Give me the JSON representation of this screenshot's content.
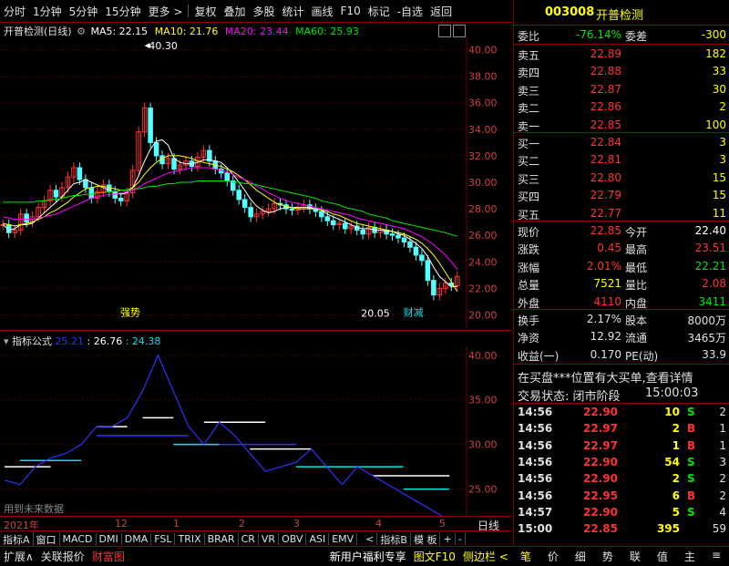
{
  "toolbar": {
    "period_tabs": [
      "分时",
      "1分钟",
      "5分钟",
      "15分钟",
      "更多 >"
    ],
    "tools": [
      "复权",
      "叠加",
      "多股",
      "统计",
      "画线",
      "F10",
      "标记",
      "-自选",
      "返回"
    ]
  },
  "stock": {
    "code": "003008",
    "name": "开普检测",
    "period_label": "开普检测(日线)"
  },
  "ma_legend": [
    {
      "label": "MA5: 22.15",
      "color": "#ffffff"
    },
    {
      "label": "MA10: 21.76",
      "color": "#ffff00"
    },
    {
      "label": "MA20: 23.44",
      "color": "#ff00ff"
    },
    {
      "label": "MA60: 25.93",
      "color": "#00e600"
    }
  ],
  "indicator": {
    "name": "指标公式",
    "values": [
      {
        "label": "25.21",
        "color": "#3030ff"
      },
      {
        "label": ": 26.76",
        "color": "#ffffff"
      },
      {
        "label": ": 24.38",
        "color": "#00e5e5"
      }
    ],
    "note": "用到未来数据"
  },
  "chart_data": [
    {
      "type": "candlestick",
      "title": "开普检测(日线)",
      "ylim": [
        19,
        41
      ],
      "yticks": [
        "40.00",
        "38.00",
        "36.00",
        "34.00",
        "32.00",
        "30.00",
        "28.00",
        "26.00",
        "24.00",
        "22.00",
        "20.00"
      ],
      "x_labels": [
        "2021年",
        "12",
        "1",
        "2",
        "3",
        "4",
        "5"
      ],
      "annotations": [
        {
          "text": "40.30"
        },
        {
          "text": "20.05"
        },
        {
          "text": "强势"
        },
        {
          "text": "财减"
        }
      ],
      "close": [
        26.8,
        26.2,
        26.4,
        27.6,
        27.0,
        27.4,
        28.1,
        28.6,
        29.4,
        28.9,
        29.6,
        30.4,
        31.1,
        30.2,
        29.6,
        28.8,
        29.3,
        29.8,
        29.3,
        28.8,
        28.6,
        29.2,
        30.9,
        33.8,
        35.6,
        33.0,
        32.0,
        31.4,
        31.8,
        31.0,
        31.3,
        31.6,
        31.2,
        31.9,
        32.4,
        31.6,
        31.0,
        30.7,
        30.1,
        29.4,
        28.7,
        28.1,
        27.4,
        27.6,
        27.8,
        28.0,
        28.4,
        28.3,
        28.0,
        27.9,
        28.1,
        28.3,
        28.0,
        27.8,
        27.4,
        27.1,
        26.8,
        26.9,
        26.5,
        26.7,
        26.4,
        26.1,
        26.6,
        26.2,
        26.4,
        26.1,
        26.0,
        25.8,
        25.5,
        25.1,
        24.5,
        24.1,
        22.6,
        21.5,
        22.0,
        22.4,
        22.2,
        22.9
      ],
      "ma_series": [
        {
          "name": "MA5",
          "color": "#ffffff",
          "values": [
            26.8,
            26.4,
            26.5,
            26.8,
            26.8,
            26.9,
            27.3,
            27.7,
            28.1,
            28.5,
            28.9,
            29.4,
            29.9,
            30.0,
            30.2,
            30.0,
            29.8,
            29.6,
            29.4,
            29.2,
            29.1,
            29.2,
            29.6,
            30.5,
            31.6,
            32.5,
            33.1,
            33.2,
            32.8,
            31.8,
            31.5,
            31.4,
            31.4,
            31.5,
            31.7,
            31.7,
            31.6,
            31.5,
            31.1,
            30.6,
            30.0,
            29.4,
            28.7,
            28.2,
            27.9,
            27.7,
            27.8,
            28.0,
            28.1,
            28.1,
            28.1,
            28.1,
            28.1,
            28.0,
            27.9,
            27.6,
            27.4,
            27.2,
            27.0,
            26.8,
            26.6,
            26.5,
            26.5,
            26.4,
            26.4,
            26.3,
            26.3,
            26.1,
            26.0,
            25.7,
            25.4,
            25.0,
            24.4,
            23.6,
            22.9,
            22.5,
            22.1,
            22.15
          ]
        },
        {
          "name": "MA10",
          "color": "#ffff00",
          "values": [
            26.9,
            26.8,
            26.7,
            26.8,
            26.9,
            27.0,
            27.2,
            27.4,
            27.7,
            27.9,
            28.2,
            28.5,
            28.9,
            29.2,
            29.5,
            29.6,
            29.7,
            29.7,
            29.6,
            29.5,
            29.4,
            29.4,
            29.6,
            30.0,
            30.6,
            31.1,
            31.5,
            31.8,
            32.0,
            32.0,
            32.0,
            31.9,
            31.8,
            31.6,
            31.5,
            31.4,
            31.3,
            31.2,
            31.0,
            30.8,
            30.5,
            30.2,
            29.8,
            29.4,
            29.1,
            28.8,
            28.5,
            28.3,
            28.2,
            28.1,
            28.0,
            28.0,
            28.0,
            28.0,
            27.9,
            27.8,
            27.6,
            27.5,
            27.3,
            27.1,
            26.9,
            26.8,
            26.7,
            26.6,
            26.5,
            26.4,
            26.3,
            26.2,
            26.1,
            25.9,
            25.7,
            25.4,
            25.0,
            24.5,
            23.9,
            23.2,
            22.5,
            21.76
          ]
        },
        {
          "name": "MA20",
          "color": "#ff00ff",
          "values": [
            27.4,
            27.3,
            27.2,
            27.2,
            27.2,
            27.2,
            27.3,
            27.4,
            27.5,
            27.6,
            27.8,
            28.0,
            28.2,
            28.4,
            28.6,
            28.8,
            28.9,
            29.0,
            29.1,
            29.1,
            29.2,
            29.3,
            29.4,
            29.6,
            29.9,
            30.1,
            30.3,
            30.5,
            30.7,
            30.8,
            30.9,
            31.0,
            31.1,
            31.1,
            31.1,
            31.1,
            31.0,
            30.9,
            30.8,
            30.6,
            30.4,
            30.2,
            30.0,
            29.7,
            29.5,
            29.2,
            29.0,
            28.8,
            28.6,
            28.5,
            28.4,
            28.3,
            28.2,
            28.1,
            28.0,
            27.9,
            27.8,
            27.7,
            27.6,
            27.5,
            27.3,
            27.2,
            27.1,
            27.0,
            26.9,
            26.8,
            26.7,
            26.6,
            26.5,
            26.3,
            26.1,
            25.9,
            25.6,
            25.3,
            24.9,
            24.5,
            24.0,
            23.44
          ]
        },
        {
          "name": "MA60",
          "color": "#00e600",
          "values": [
            28.5,
            28.5,
            28.5,
            28.5,
            28.5,
            28.5,
            28.6,
            28.6,
            28.7,
            28.7,
            28.8,
            28.9,
            29.0,
            29.0,
            29.1,
            29.1,
            29.2,
            29.2,
            29.3,
            29.3,
            29.4,
            29.4,
            29.5,
            29.5,
            29.6,
            29.7,
            29.7,
            29.8,
            29.9,
            29.9,
            30.0,
            30.0,
            30.0,
            30.1,
            30.1,
            30.1,
            30.1,
            30.1,
            30.1,
            30.0,
            30.0,
            29.9,
            29.9,
            29.8,
            29.7,
            29.6,
            29.5,
            29.4,
            29.3,
            29.2,
            29.1,
            29.0,
            28.9,
            28.8,
            28.6,
            28.5,
            28.4,
            28.3,
            28.1,
            28.0,
            27.9,
            27.8,
            27.6,
            27.5,
            27.4,
            27.3,
            27.1,
            27.0,
            26.9,
            26.8,
            26.7,
            26.6,
            26.5,
            26.4,
            26.3,
            26.2,
            26.05,
            25.93
          ]
        }
      ]
    },
    {
      "type": "line",
      "title": "指标公式",
      "ylim": [
        22,
        41
      ],
      "yticks": [
        "40.00",
        "35.00",
        "30.00",
        "25.00"
      ],
      "series": [
        {
          "name": "",
          "color": "#3030ff",
          "values": [
            26.0,
            25.5,
            27.5,
            28.5,
            29.0,
            30.0,
            32.0,
            32.0,
            33.0,
            36.0,
            40.0,
            36.0,
            32.0,
            30.0,
            32.5,
            31.0,
            29.0,
            27.0,
            27.5,
            28.0,
            29.5,
            27.5,
            25.5,
            27.5,
            26.5,
            25.5,
            24.5,
            23.5,
            22.5,
            21.5
          ]
        }
      ],
      "segments": [
        {
          "color": "#ffffff",
          "y": 27.5,
          "from": 0,
          "to": 3
        },
        {
          "color": "#00e5e5",
          "y": 28.2,
          "from": 1,
          "to": 5
        },
        {
          "color": "#ffffff",
          "y": 32.0,
          "from": 6,
          "to": 8
        },
        {
          "color": "#3030ff",
          "y": 31.0,
          "from": 6,
          "to": 12
        },
        {
          "color": "#ffffff",
          "y": 33.0,
          "from": 9,
          "to": 11
        },
        {
          "color": "#3030ff",
          "y": 30.0,
          "from": 11,
          "to": 19
        },
        {
          "color": "#00e5e5",
          "y": 30.0,
          "from": 11,
          "to": 14
        },
        {
          "color": "#ffffff",
          "y": 32.5,
          "from": 13,
          "to": 17
        },
        {
          "color": "#ffffff",
          "y": 29.5,
          "from": 16,
          "to": 20
        },
        {
          "color": "#00e5e5",
          "y": 27.5,
          "from": 19,
          "to": 26
        },
        {
          "color": "#ffffff",
          "y": 26.5,
          "from": 24,
          "to": 29
        },
        {
          "color": "#00e5e5",
          "y": 25.0,
          "from": 26,
          "to": 29
        }
      ]
    }
  ],
  "quote": {
    "webi_label": "委比",
    "webi": "-76.14%",
    "weicha_label": "委差",
    "weicha": "-300",
    "asks": [
      {
        "label": "卖五",
        "price": "22.89",
        "vol": "182"
      },
      {
        "label": "卖四",
        "price": "22.88",
        "vol": "33"
      },
      {
        "label": "卖三",
        "price": "22.87",
        "vol": "30"
      },
      {
        "label": "卖二",
        "price": "22.86",
        "vol": "2"
      },
      {
        "label": "卖一",
        "price": "22.85",
        "vol": "100"
      }
    ],
    "bids": [
      {
        "label": "买一",
        "price": "22.84",
        "vol": "3"
      },
      {
        "label": "买二",
        "price": "22.81",
        "vol": "3"
      },
      {
        "label": "买三",
        "price": "22.80",
        "vol": "15"
      },
      {
        "label": "买四",
        "price": "22.79",
        "vol": "15"
      },
      {
        "label": "买五",
        "price": "22.77",
        "vol": "11"
      }
    ],
    "stats": [
      {
        "l1": "现价",
        "v1": "22.85",
        "c1": "#ff3232",
        "l2": "今开",
        "v2": "22.40",
        "c2": "#ffffff"
      },
      {
        "l1": "涨跌",
        "v1": "0.45",
        "c1": "#ff3232",
        "l2": "最高",
        "v2": "23.51",
        "c2": "#ff3232"
      },
      {
        "l1": "涨幅",
        "v1": "2.01%",
        "c1": "#ff3232",
        "l2": "最低",
        "v2": "22.21",
        "c2": "#00e600"
      },
      {
        "l1": "总量",
        "v1": "7521",
        "c1": "#ffff00",
        "l2": "量比",
        "v2": "2.08",
        "c2": "#ff3232"
      },
      {
        "l1": "外盘",
        "v1": "4110",
        "c1": "#ff3232",
        "l2": "内盘",
        "v2": "3411",
        "c2": "#00e600"
      }
    ],
    "stats2": [
      {
        "l1": "换手",
        "v1": "2.17%",
        "l2": "股本",
        "v2": "8000万"
      },
      {
        "l1": "净资",
        "v1": "12.92",
        "l2": "流通",
        "v2": "3465万"
      },
      {
        "l1": "收益(一)",
        "v1": "0.170",
        "l2": "PE(动)",
        "v2": "33.9"
      }
    ],
    "notice": "在买盘***位置有大买单,查看详情",
    "trade_status_label": "交易状态: 闭市阶段",
    "trade_status_time": "15:00:03"
  },
  "ticks": [
    {
      "time": "14:56",
      "price": "22.90",
      "vol": "10",
      "bs": "S",
      "bs_color": "#00e600",
      "n": "2"
    },
    {
      "time": "14:56",
      "price": "22.97",
      "vol": "2",
      "bs": "B",
      "bs_color": "#ff3232",
      "n": "1"
    },
    {
      "time": "14:56",
      "price": "22.97",
      "vol": "1",
      "bs": "B",
      "bs_color": "#ff3232",
      "n": "1"
    },
    {
      "time": "14:56",
      "price": "22.90",
      "vol": "54",
      "bs": "S",
      "bs_color": "#00e600",
      "n": "3"
    },
    {
      "time": "14:56",
      "price": "22.90",
      "vol": "2",
      "bs": "S",
      "bs_color": "#00e600",
      "n": "2"
    },
    {
      "time": "14:56",
      "price": "22.95",
      "vol": "6",
      "bs": "B",
      "bs_color": "#ff3232",
      "n": "2"
    },
    {
      "time": "14:57",
      "price": "22.90",
      "vol": "5",
      "bs": "S",
      "bs_color": "#00e600",
      "n": "4"
    },
    {
      "time": "15:00",
      "price": "22.85",
      "vol": "395",
      "bs": "",
      "bs_color": "#00e600",
      "n": "59"
    }
  ],
  "bottom_tabs": [
    "指标A",
    "窗口",
    "MACD",
    "DMI",
    "DMA",
    "FSL",
    "TRIX",
    "BRAR",
    "CR",
    "VR",
    "OBV",
    "ASI",
    "EMV",
    "<",
    "指标B",
    "模 板",
    "+",
    "-"
  ],
  "daily_label": "日线",
  "status_left": [
    "扩展∧",
    "关联报价",
    "财富图"
  ],
  "status_mid": [
    "新用户福利专享",
    "图文F10",
    "侧边栏 <"
  ],
  "status_right": [
    "笔",
    "价",
    "细",
    "势",
    "联",
    "值",
    "主",
    "≡"
  ]
}
